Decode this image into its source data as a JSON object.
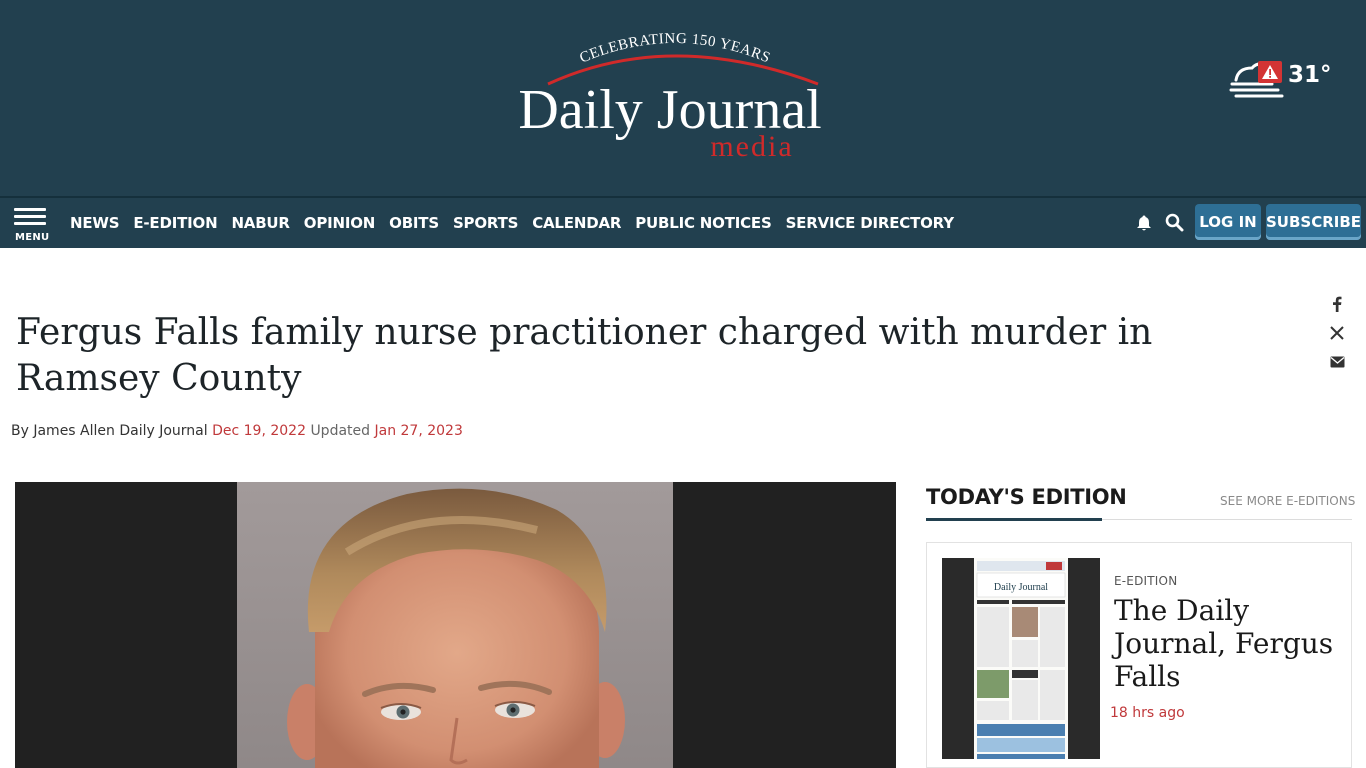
{
  "masthead": {
    "tagline": "CELEBRATING 150 YEARS",
    "logo_main": "Daily Journal",
    "logo_sub": "media",
    "weather_temp": "31°",
    "weather_icon": "weather-alert-icon"
  },
  "nav": {
    "menu_label": "MENU",
    "items": [
      "NEWS",
      "E-EDITION",
      "NABUR",
      "OPINION",
      "OBITS",
      "SPORTS",
      "CALENDAR",
      "PUBLIC NOTICES",
      "SERVICE DIRECTORY"
    ],
    "login_label": "LOG IN",
    "subscribe_label": "SUBSCRIBE",
    "bell_icon": "bell-icon",
    "search_icon": "search-icon"
  },
  "article": {
    "headline": "Fergus Falls family nurse practitioner charged with murder in Ramsey County",
    "byline_prefix": "By",
    "author": "James Allen Daily Journal",
    "published": "Dec 19, 2022",
    "updated_label": "Updated",
    "updated": "Jan 27, 2023",
    "share_icons": [
      "facebook-icon",
      "x-twitter-icon",
      "email-icon"
    ]
  },
  "sidebar": {
    "title": "TODAY'S EDITION",
    "see_more": "SEE MORE E-EDITIONS",
    "card": {
      "kicker": "E-EDITION",
      "title": "The Daily Journal, Fergus Falls",
      "time": "18 hrs ago"
    }
  },
  "colors": {
    "masthead_bg": "#22404f",
    "button_blue": "#2e6f95",
    "accent_red": "#c0393b"
  }
}
